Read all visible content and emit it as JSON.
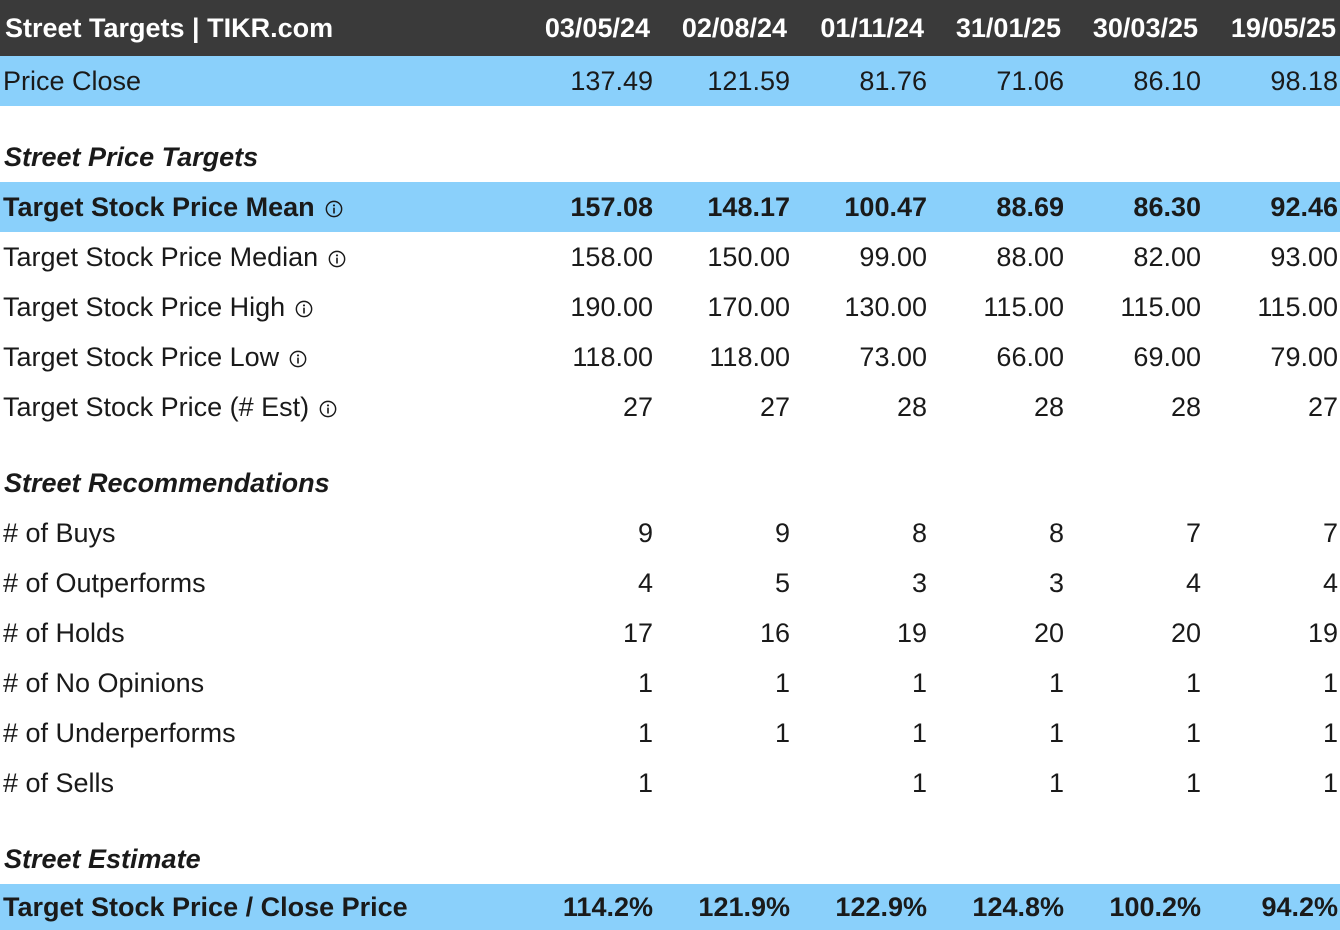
{
  "header": {
    "title": "Street Targets | TIKR.com",
    "dates": [
      "03/05/24",
      "02/08/24",
      "01/11/24",
      "31/01/25",
      "30/03/25",
      "19/05/25"
    ]
  },
  "price_close": {
    "label": "Price Close",
    "values": [
      "137.49",
      "121.59",
      "81.76",
      "71.06",
      "86.10",
      "98.18"
    ]
  },
  "sections": {
    "targets": "Street Price Targets",
    "recommendations": "Street Recommendations",
    "estimate": "Street Estimate"
  },
  "targets": [
    {
      "label": "Target Stock Price Mean",
      "values": [
        "157.08",
        "148.17",
        "100.47",
        "88.69",
        "86.30",
        "92.46"
      ]
    },
    {
      "label": "Target Stock Price Median",
      "values": [
        "158.00",
        "150.00",
        "99.00",
        "88.00",
        "82.00",
        "93.00"
      ]
    },
    {
      "label": "Target Stock Price High",
      "values": [
        "190.00",
        "170.00",
        "130.00",
        "115.00",
        "115.00",
        "115.00"
      ]
    },
    {
      "label": "Target Stock Price Low",
      "values": [
        "118.00",
        "118.00",
        "73.00",
        "66.00",
        "69.00",
        "79.00"
      ]
    },
    {
      "label": "Target Stock Price (# Est)",
      "values": [
        "27",
        "27",
        "28",
        "28",
        "28",
        "27"
      ]
    }
  ],
  "recommendations": [
    {
      "label": "# of Buys",
      "values": [
        "9",
        "9",
        "8",
        "8",
        "7",
        "7"
      ]
    },
    {
      "label": "# of Outperforms",
      "values": [
        "4",
        "5",
        "3",
        "3",
        "4",
        "4"
      ]
    },
    {
      "label": "# of Holds",
      "values": [
        "17",
        "16",
        "19",
        "20",
        "20",
        "19"
      ]
    },
    {
      "label": "# of No Opinions",
      "values": [
        "1",
        "1",
        "1",
        "1",
        "1",
        "1"
      ]
    },
    {
      "label": "# of Underperforms",
      "values": [
        "1",
        "1",
        "1",
        "1",
        "1",
        "1"
      ]
    },
    {
      "label": "# of Sells",
      "values": [
        "1",
        "",
        "1",
        "1",
        "1",
        "1"
      ]
    }
  ],
  "estimate": {
    "label": "Target Stock Price / Close Price",
    "values": [
      "114.2%",
      "121.9%",
      "122.9%",
      "124.8%",
      "100.2%",
      "94.2%"
    ]
  },
  "colors": {
    "header_bg": "#3a3a3a",
    "highlight_bg": "#8ad0fb"
  },
  "icons": {
    "info": "info-circle-icon"
  }
}
